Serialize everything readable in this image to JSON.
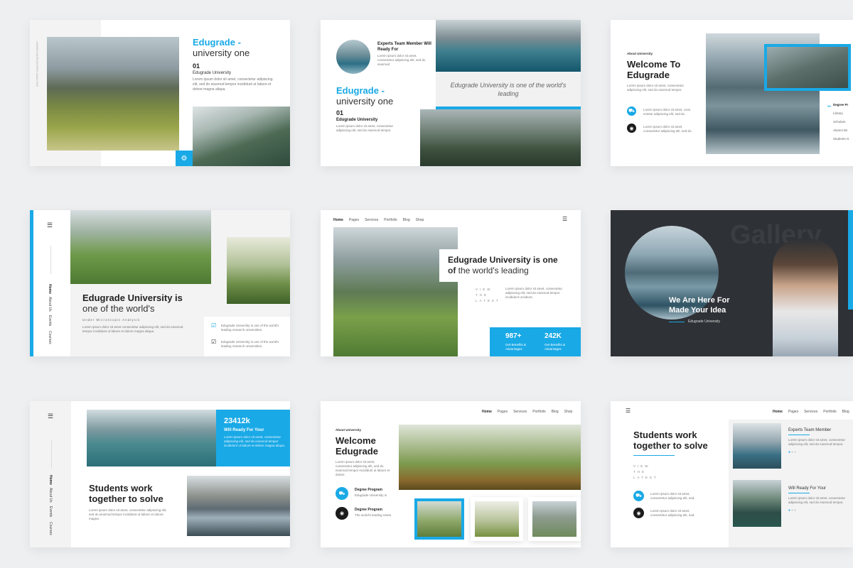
{
  "s1": {
    "title_bold": "Edugrade -",
    "title_light": "university one",
    "number": "01",
    "subtitle": "Edugrade University",
    "body": "Lorem ipsum dolor sit amet, consectetur adipiscing elit, sed do eiusmod tempor incididunt ut labore et dolore magna aliqua."
  },
  "s2": {
    "heading": "Experts Team Member Will Ready For",
    "heading_body": "Lorem ipsum dolor sit amet, consectetur adipiscing elit, sed do eiusmod.",
    "title_bold": "Edugrade -",
    "title_light": "university one",
    "number": "01",
    "subtitle": "Edugrade University",
    "body": "Lorem ipsum dolor sit amet, consectetur adipiscing elit, sed do eiusmod tempor.",
    "quote": "Edugrade University is one of the world's leading"
  },
  "s3": {
    "eyebrow": "About University",
    "title": "Welcome To Edugrade",
    "body": "Lorem ipsum dolor sit amet, consectetur adipiscing elit, sed do eiusmod tempor.",
    "item1": "Lorem ipsum dolor sit amet, cons ectetur adipiscing elit, sed do.",
    "item2": "Lorem ipsum dolor sit amet, consectetur adipiscing elit, sed do.",
    "list": [
      "Degree Pr",
      "Library",
      "Scholars",
      "Alumni Dir",
      "Students G"
    ]
  },
  "s4": {
    "title_bold": "Edugrade University is",
    "title_light": "one of the world's",
    "subtitle": "Under Microscopic Analysis",
    "body": "Lorem ipsum dolor sit amet consectetur adipiscing elit, sed do eiusmod tempor incididunt ut labore et dolore magna aliqua.",
    "check1": "Edugrade University is one of the world's leading research universities.",
    "check2": "Edugrade University is one of the world's leading research universities.",
    "nav": [
      "Home",
      "About Us",
      "Events",
      "Courses"
    ]
  },
  "s5": {
    "nav": [
      "Home",
      "Pages",
      "Services",
      "Portfolio",
      "Blog",
      "Shop"
    ],
    "title_bold": "Edugrade University is one",
    "title_of": "of",
    "title_light": " the world's leading",
    "view_latest": "VIEW THE LATEST",
    "body": "Lorem ipsum dolor sit amet, consectetur adipiscing elit, sed do eiusmod tempor incididunt ut labore.",
    "stat1_value": "987+",
    "stat1_label": "Get Benefits & Advantages",
    "stat2_value": "242K",
    "stat2_label": "Get Benefits & Advantages"
  },
  "s6": {
    "bg_word": "Gallery",
    "title": "We Are Here For Made Your Idea",
    "subtitle": "Edugrade University"
  },
  "s7": {
    "stat": "23412k",
    "stat_label": "Will Ready For Your",
    "stat_body": "Lorem ipsum dolor sit amet, consectetur adipiscing elit, sed do eiusmod tempor incididunt ut labore et dolore magna aliqua.",
    "title": "Students work together to solve",
    "body": "Lorem ipsum dolor sit amet, consectetur adipiscing elit, sed do eiusmod tempor incididunt ut labore et dolore magna.",
    "nav": [
      "Home",
      "About Us",
      "Events",
      "Courses"
    ]
  },
  "s8": {
    "nav": [
      "Home",
      "Pages",
      "Services",
      "Portfolio",
      "Blog",
      "Shop"
    ],
    "eyebrow": "About University",
    "title": "Welcome Edugrade",
    "body": "Lorem ipsum dolor sit amet, consectetur adipiscing elit, sed do eiusmod tempor incididunt ut labore et dolore.",
    "item1_title": "Degree Program",
    "item1_body": "Edugrade University is",
    "item2_title": "Degree Program",
    "item2_body": "The world's leading resea"
  },
  "s9": {
    "nav": [
      "Home",
      "Pages",
      "Services",
      "Portfolio",
      "Blog"
    ],
    "title": "Students work together to solve",
    "view_latest": "VIEW THE LATEST",
    "item1": "Lorem ipsum dolor sit amet, consectetur adipiscing elit, sed.",
    "item2": "Lorem ipsum dolor sit amet, consectetur adipiscing elit, sed.",
    "card1_title": "Experts Team Member",
    "card1_body": "Lorem ipsum dolor sit amet, consectetur adipiscing elit, sed do eiusmod tempor.",
    "card2_title": "Will Ready For Your",
    "card2_body": "Lorem ipsum dolor sit amet, consectetur adipiscing elit, sed do eiusmod tempor."
  },
  "icons": [
    "gear-icon",
    "car-icon",
    "camera-icon",
    "menu-icon",
    "check-icon"
  ],
  "colors": {
    "accent": "#19a9e6",
    "dark": "#2e3136",
    "page_bg": "#eeeff1"
  }
}
